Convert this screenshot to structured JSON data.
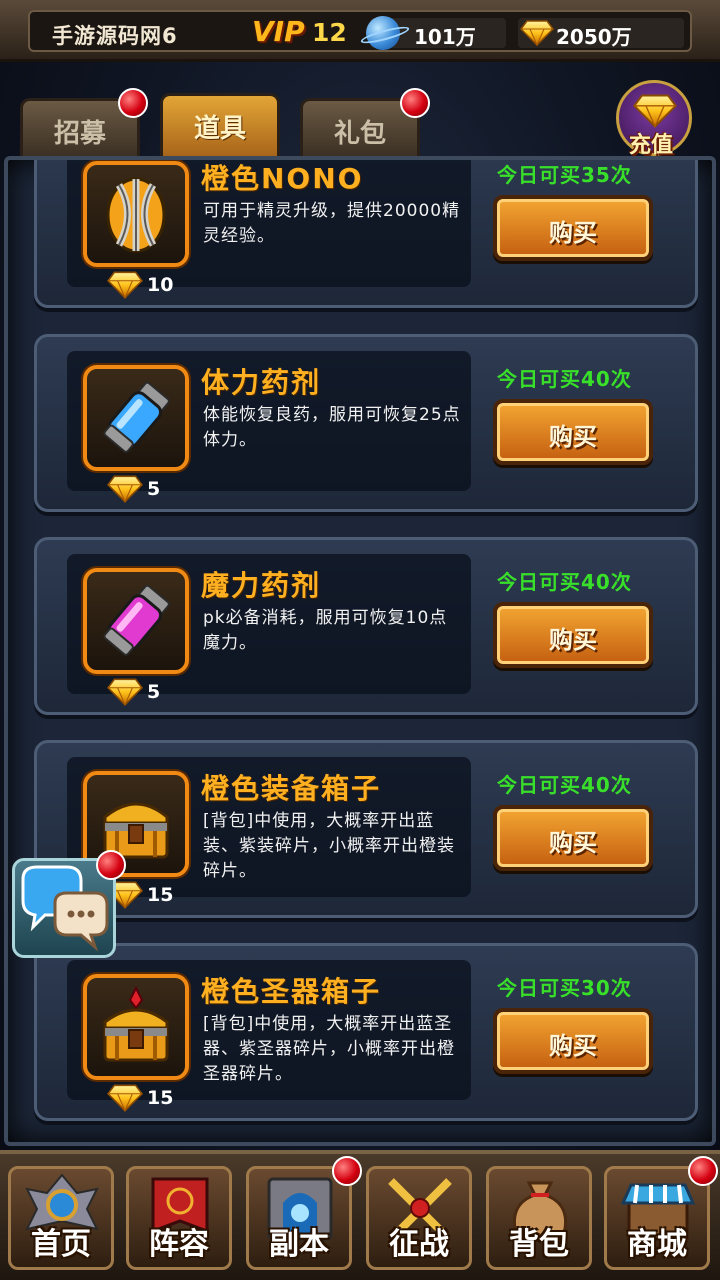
{
  "header": {
    "player_name": "手游源码网6",
    "vip_label": "VIP",
    "vip_level": "12",
    "coins": "101万",
    "gems": "2050万"
  },
  "tabs": [
    {
      "label": "招募",
      "active": false,
      "badge": true
    },
    {
      "label": "道具",
      "active": true,
      "badge": false
    },
    {
      "label": "礼包",
      "active": false,
      "badge": true
    }
  ],
  "recharge_label": "充值",
  "items": [
    {
      "name": "橙色NONO",
      "desc": "可用于精灵升级，提供20000精灵经验。",
      "price": "10",
      "limit": "今日可买35次",
      "buy": "购买",
      "icon": "orange-nono-egg-icon"
    },
    {
      "name": "体力药剂",
      "desc": "体能恢复良药，服用可恢复25点体力。",
      "price": "5",
      "limit": "今日可买40次",
      "buy": "购买",
      "icon": "blue-potion-icon"
    },
    {
      "name": "魔力药剂",
      "desc": "pk必备消耗，服用可恢复10点魔力。",
      "price": "5",
      "limit": "今日可买40次",
      "buy": "购买",
      "icon": "pink-potion-icon"
    },
    {
      "name": "橙色装备箱子",
      "desc": "[背包]中使用，大概率开出蓝装、紫装碎片，小概率开出橙装碎片。",
      "price": "15",
      "limit": "今日可买40次",
      "buy": "购买",
      "icon": "orange-equipment-chest-icon"
    },
    {
      "name": "橙色圣器箱子",
      "desc": "[背包]中使用，大概率开出蓝圣器、紫圣器碎片，小概率开出橙圣器碎片。",
      "price": "15",
      "limit": "今日可买30次",
      "buy": "购买",
      "icon": "orange-artifact-chest-icon"
    }
  ],
  "nav": [
    {
      "label": "首页",
      "badge": false
    },
    {
      "label": "阵容",
      "badge": false
    },
    {
      "label": "副本",
      "badge": true
    },
    {
      "label": "征战",
      "badge": false
    },
    {
      "label": "背包",
      "badge": false
    },
    {
      "label": "商城",
      "badge": true
    }
  ],
  "colors": {
    "accent_orange": "#f08a14",
    "limit_green": "#38e02a",
    "item_name_gold": "#ffb020",
    "badge_red": "#d40010"
  }
}
